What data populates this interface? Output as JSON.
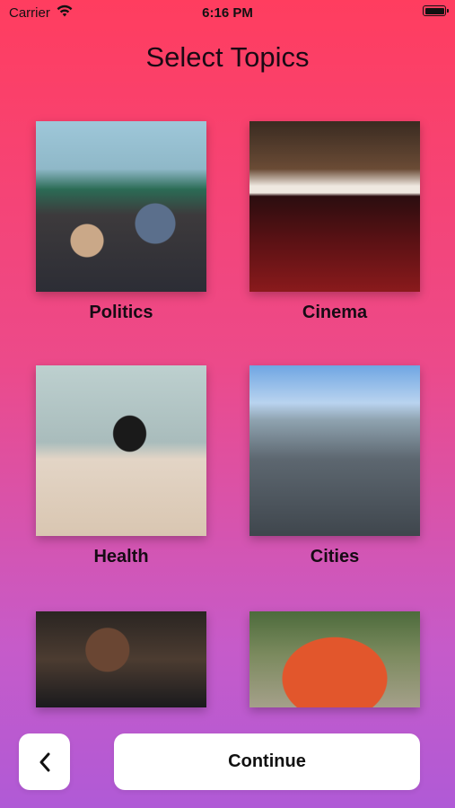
{
  "status_bar": {
    "carrier": "Carrier",
    "time": "6:16 PM"
  },
  "page": {
    "title": "Select Topics"
  },
  "topics": [
    {
      "label": "Politics",
      "image": "protest-crowd-photo"
    },
    {
      "label": "Cinema",
      "image": "theater-seats-photo"
    },
    {
      "label": "Health",
      "image": "runner-on-beach-photo"
    },
    {
      "label": "Cities",
      "image": "city-skyline-photo"
    },
    {
      "label": "",
      "image": "speaker-at-microphone-photo"
    },
    {
      "label": "",
      "image": "orange-vintage-car-photo"
    }
  ],
  "footer": {
    "back_icon": "chevron-left-icon",
    "continue_label": "Continue"
  },
  "colors": {
    "gradient_top": "#ff3d5f",
    "gradient_bottom": "#b05ad6",
    "button_bg": "#ffffff"
  }
}
